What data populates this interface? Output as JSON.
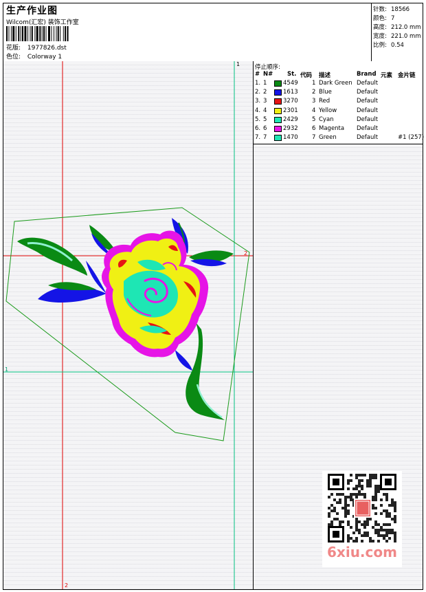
{
  "header": {
    "title": "生产作业图",
    "company": "Wilcom(汇宏) 装饰工作室",
    "design_label": "花版:",
    "design_value": "1977826.dst",
    "colorway_label": "色位:",
    "colorway_value": "Colorway 1"
  },
  "stats": [
    {
      "key": "针数:",
      "value": "18566"
    },
    {
      "key": "颜色:",
      "value": "7"
    },
    {
      "key": "高度:",
      "value": "212.0 mm"
    },
    {
      "key": "宽度:",
      "value": "221.0 mm"
    },
    {
      "key": "比例:",
      "value": "0.54"
    }
  ],
  "stop_sequence": {
    "title": "停止顺序:",
    "headers": [
      "#",
      "N#",
      "St.",
      "代码",
      "描述",
      "Brand",
      "元素",
      "金片链"
    ],
    "rows": [
      {
        "idx": "1.",
        "n": "1",
        "color": "#0a8a14",
        "st": "4549",
        "code": "1",
        "desc": "Dark Green",
        "brand": "Default",
        "element": "",
        "sequin": ""
      },
      {
        "idx": "2.",
        "n": "2",
        "color": "#1414e6",
        "st": "1613",
        "code": "2",
        "desc": "Blue",
        "brand": "Default",
        "element": "",
        "sequin": ""
      },
      {
        "idx": "3.",
        "n": "3",
        "color": "#e61414",
        "st": "3270",
        "code": "3",
        "desc": "Red",
        "brand": "Default",
        "element": "",
        "sequin": ""
      },
      {
        "idx": "4.",
        "n": "4",
        "color": "#f0f014",
        "st": "2301",
        "code": "4",
        "desc": "Yellow",
        "brand": "Default",
        "element": "",
        "sequin": ""
      },
      {
        "idx": "5.",
        "n": "5",
        "color": "#1ee6b4",
        "st": "2429",
        "code": "5",
        "desc": "Cyan",
        "brand": "Default",
        "element": "",
        "sequin": ""
      },
      {
        "idx": "6.",
        "n": "6",
        "color": "#e614e6",
        "st": "2932",
        "code": "6",
        "desc": "Magenta",
        "brand": "Default",
        "element": "",
        "sequin": ""
      },
      {
        "idx": "7.",
        "n": "7",
        "color": "#1ee6b4",
        "st": "1470",
        "code": "7",
        "desc": "Green",
        "brand": "Default",
        "element": "",
        "sequin": "#1 (257)"
      }
    ]
  },
  "axis_labels": {
    "top_right": "1",
    "red_h": "2",
    "green_h": "1",
    "red_v": "2"
  },
  "watermark": {
    "text": "6xiu.com",
    "seal_chars": "六秀"
  },
  "colors": {
    "guide_red": "#e00000",
    "guide_green": "#00c080",
    "outline_green": "#1a9a1a"
  }
}
